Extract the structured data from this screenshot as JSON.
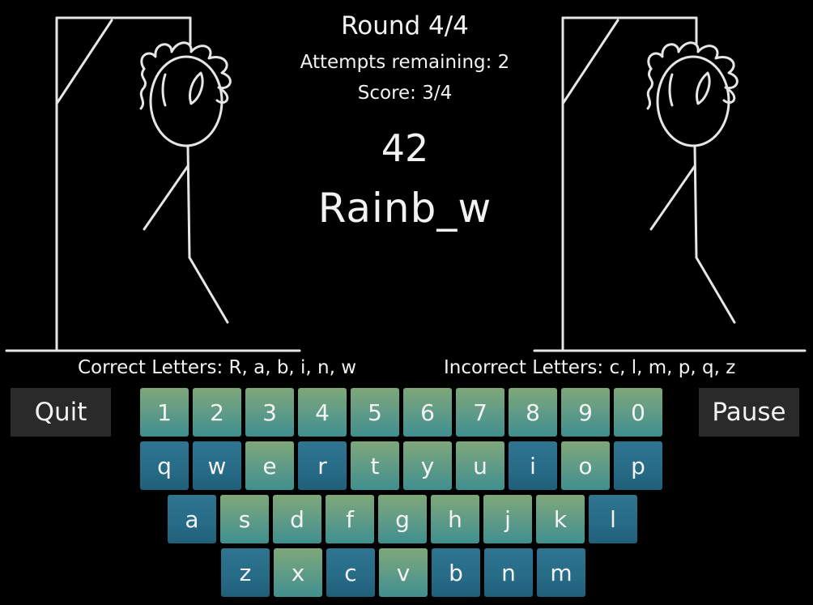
{
  "hud": {
    "round": "Round 4/4",
    "attempts": "Attempts remaining: 2",
    "score": "Score: 3/4",
    "timer": "42",
    "word": "Rainb_w"
  },
  "letters": {
    "correct": "Correct Letters: R, a, b, i, n, w",
    "incorrect": "Incorrect Letters: c, l, m, p, q, z"
  },
  "buttons": {
    "quit": "Quit",
    "pause": "Pause"
  },
  "keyboard": {
    "digits": [
      {
        "label": "1",
        "state": "avail"
      },
      {
        "label": "2",
        "state": "avail"
      },
      {
        "label": "3",
        "state": "avail"
      },
      {
        "label": "4",
        "state": "avail"
      },
      {
        "label": "5",
        "state": "avail"
      },
      {
        "label": "6",
        "state": "avail"
      },
      {
        "label": "7",
        "state": "avail"
      },
      {
        "label": "8",
        "state": "avail"
      },
      {
        "label": "9",
        "state": "avail"
      },
      {
        "label": "0",
        "state": "avail"
      }
    ],
    "top": [
      {
        "label": "q",
        "state": "used"
      },
      {
        "label": "w",
        "state": "used"
      },
      {
        "label": "e",
        "state": "avail"
      },
      {
        "label": "r",
        "state": "used"
      },
      {
        "label": "t",
        "state": "avail"
      },
      {
        "label": "y",
        "state": "avail"
      },
      {
        "label": "u",
        "state": "avail"
      },
      {
        "label": "i",
        "state": "used"
      },
      {
        "label": "o",
        "state": "avail"
      },
      {
        "label": "p",
        "state": "used"
      }
    ],
    "mid": [
      {
        "label": "a",
        "state": "used"
      },
      {
        "label": "s",
        "state": "avail"
      },
      {
        "label": "d",
        "state": "avail"
      },
      {
        "label": "f",
        "state": "avail"
      },
      {
        "label": "g",
        "state": "avail"
      },
      {
        "label": "h",
        "state": "avail"
      },
      {
        "label": "j",
        "state": "avail"
      },
      {
        "label": "k",
        "state": "avail"
      },
      {
        "label": "l",
        "state": "used"
      }
    ],
    "bot": [
      {
        "label": "z",
        "state": "used"
      },
      {
        "label": "x",
        "state": "avail"
      },
      {
        "label": "c",
        "state": "used"
      },
      {
        "label": "v",
        "state": "avail"
      },
      {
        "label": "b",
        "state": "used"
      },
      {
        "label": "n",
        "state": "used"
      },
      {
        "label": "m",
        "state": "used"
      }
    ]
  },
  "colors": {
    "background": "#000000",
    "key_available": "#6aa083",
    "key_used": "#2a6e88",
    "button_bg": "#2a2a2a",
    "line": "#e6e6e6"
  },
  "icons": [
    "hangman-gallows-figure"
  ]
}
